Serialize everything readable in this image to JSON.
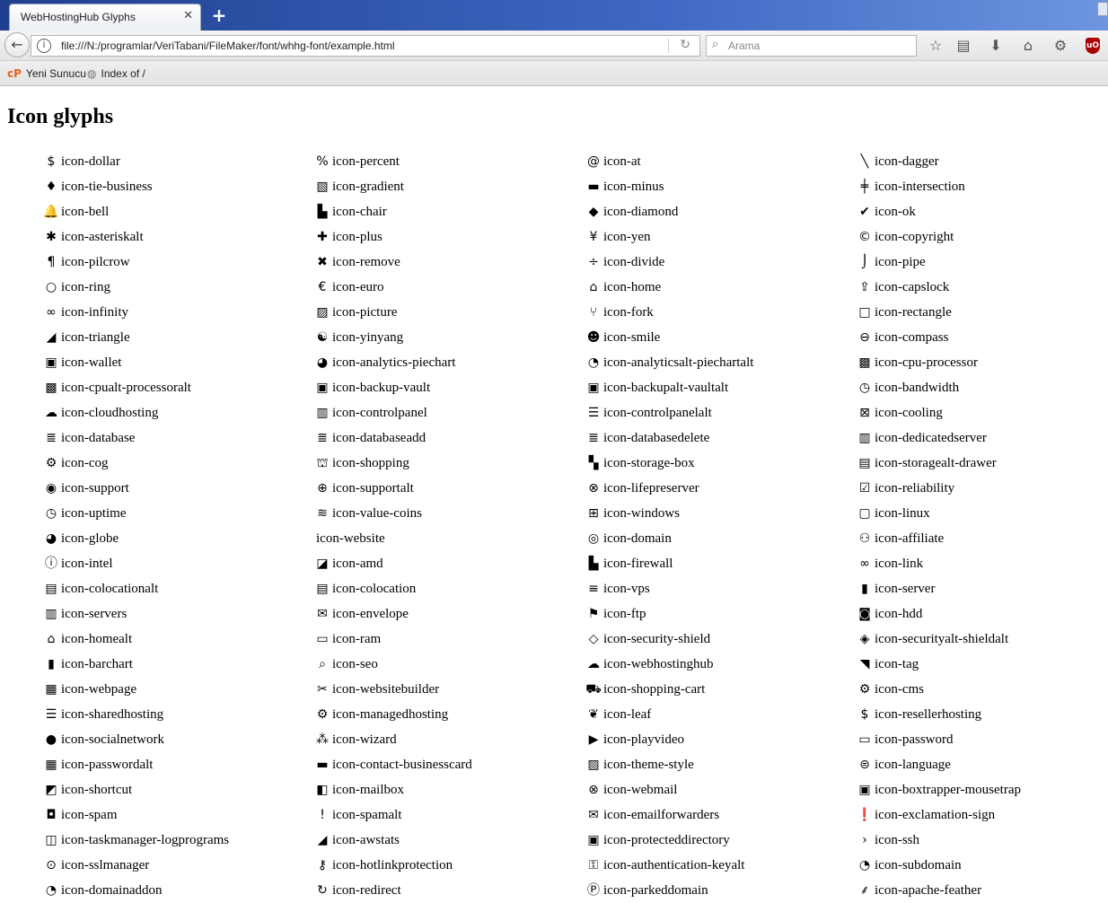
{
  "window": {
    "tab_title": "WebHostingHub Glyphs",
    "tab_close": "✕",
    "new_tab": "+"
  },
  "navbar": {
    "url": "file:///N:/programlar/VeriTabani/FileMaker/font/whhg-font/example.html",
    "search_placeholder": "Arama"
  },
  "bookmarks": [
    {
      "label": "Yeni Sunucu",
      "icon": "cpanel-icon"
    },
    {
      "label": "Index of /",
      "icon": "globe-icon"
    }
  ],
  "page": {
    "heading": "Icon glyphs"
  },
  "icon_columns": [
    [
      {
        "label": "icon-dollar",
        "glyph": "$"
      },
      {
        "label": "icon-tie-business",
        "glyph": "♦"
      },
      {
        "label": "icon-bell",
        "glyph": "🔔"
      },
      {
        "label": "icon-asteriskalt",
        "glyph": "✱"
      },
      {
        "label": "icon-pilcrow",
        "glyph": "¶"
      },
      {
        "label": "icon-ring",
        "glyph": "○"
      },
      {
        "label": "icon-infinity",
        "glyph": "∞"
      },
      {
        "label": "icon-triangle",
        "glyph": "◢"
      },
      {
        "label": "icon-wallet",
        "glyph": "▣"
      },
      {
        "label": "icon-cpualt-processoralt",
        "glyph": "▩"
      },
      {
        "label": "icon-cloudhosting",
        "glyph": "☁"
      },
      {
        "label": "icon-database",
        "glyph": "≣"
      },
      {
        "label": "icon-cog",
        "glyph": "⚙"
      },
      {
        "label": "icon-support",
        "glyph": "◉"
      },
      {
        "label": "icon-uptime",
        "glyph": "◷"
      },
      {
        "label": "icon-globe",
        "glyph": "◕"
      },
      {
        "label": "icon-intel",
        "glyph": "ⓘ"
      },
      {
        "label": "icon-colocationalt",
        "glyph": "▤"
      },
      {
        "label": "icon-servers",
        "glyph": "▥"
      },
      {
        "label": "icon-homealt",
        "glyph": "⌂"
      },
      {
        "label": "icon-barchart",
        "glyph": "▮"
      },
      {
        "label": "icon-webpage",
        "glyph": "▦"
      },
      {
        "label": "icon-sharedhosting",
        "glyph": "☰"
      },
      {
        "label": "icon-socialnetwork",
        "glyph": "●"
      },
      {
        "label": "icon-passwordalt",
        "glyph": "▦"
      },
      {
        "label": "icon-shortcut",
        "glyph": "◩"
      },
      {
        "label": "icon-spam",
        "glyph": "◘"
      },
      {
        "label": "icon-taskmanager-logprograms",
        "glyph": "◫"
      },
      {
        "label": "icon-sslmanager",
        "glyph": "⊙"
      },
      {
        "label": "icon-domainaddon",
        "glyph": "◔"
      }
    ],
    [
      {
        "label": "icon-percent",
        "glyph": "%"
      },
      {
        "label": "icon-gradient",
        "glyph": "▧"
      },
      {
        "label": "icon-chair",
        "glyph": "▙"
      },
      {
        "label": "icon-plus",
        "glyph": "✚"
      },
      {
        "label": "icon-remove",
        "glyph": "✖"
      },
      {
        "label": "icon-euro",
        "glyph": "€"
      },
      {
        "label": "icon-picture",
        "glyph": "▨"
      },
      {
        "label": "icon-yinyang",
        "glyph": "☯"
      },
      {
        "label": "icon-analytics-piechart",
        "glyph": "◕"
      },
      {
        "label": "icon-backup-vault",
        "glyph": "▣"
      },
      {
        "label": "icon-controlpanel",
        "glyph": "▥"
      },
      {
        "label": "icon-databaseadd",
        "glyph": "≣"
      },
      {
        "label": "icon-shopping",
        "glyph": "⛫"
      },
      {
        "label": "icon-supportalt",
        "glyph": "⊕"
      },
      {
        "label": "icon-value-coins",
        "glyph": "≋"
      },
      {
        "label": "icon-website",
        "glyph": ""
      },
      {
        "label": "icon-amd",
        "glyph": "◪"
      },
      {
        "label": "icon-colocation",
        "glyph": "▤"
      },
      {
        "label": "icon-envelope",
        "glyph": "✉"
      },
      {
        "label": "icon-ram",
        "glyph": "▭"
      },
      {
        "label": "icon-seo",
        "glyph": "⌕"
      },
      {
        "label": "icon-websitebuilder",
        "glyph": "✂"
      },
      {
        "label": "icon-managedhosting",
        "glyph": "⚙"
      },
      {
        "label": "icon-wizard",
        "glyph": "⁂"
      },
      {
        "label": "icon-contact-businesscard",
        "glyph": "▬"
      },
      {
        "label": "icon-mailbox",
        "glyph": "◧"
      },
      {
        "label": "icon-spamalt",
        "glyph": "!"
      },
      {
        "label": "icon-awstats",
        "glyph": "◢"
      },
      {
        "label": "icon-hotlinkprotection",
        "glyph": "⚷"
      },
      {
        "label": "icon-redirect",
        "glyph": "↻"
      }
    ],
    [
      {
        "label": "icon-at",
        "glyph": "@"
      },
      {
        "label": "icon-minus",
        "glyph": "▬"
      },
      {
        "label": "icon-diamond",
        "glyph": "◆"
      },
      {
        "label": "icon-yen",
        "glyph": "¥"
      },
      {
        "label": "icon-divide",
        "glyph": "÷"
      },
      {
        "label": "icon-home",
        "glyph": "⌂"
      },
      {
        "label": "icon-fork",
        "glyph": "⑂"
      },
      {
        "label": "icon-smile",
        "glyph": "☻"
      },
      {
        "label": "icon-analyticsalt-piechartalt",
        "glyph": "◔"
      },
      {
        "label": "icon-backupalt-vaultalt",
        "glyph": "▣"
      },
      {
        "label": "icon-controlpanelalt",
        "glyph": "☰"
      },
      {
        "label": "icon-databasedelete",
        "glyph": "≣"
      },
      {
        "label": "icon-storage-box",
        "glyph": "▚"
      },
      {
        "label": "icon-lifepreserver",
        "glyph": "⊗"
      },
      {
        "label": "icon-windows",
        "glyph": "⊞"
      },
      {
        "label": "icon-domain",
        "glyph": "◎"
      },
      {
        "label": "icon-firewall",
        "glyph": "▙"
      },
      {
        "label": "icon-vps",
        "glyph": "≡"
      },
      {
        "label": "icon-ftp",
        "glyph": "⚑"
      },
      {
        "label": "icon-security-shield",
        "glyph": "◇"
      },
      {
        "label": "icon-webhostinghub",
        "glyph": "☁"
      },
      {
        "label": "icon-shopping-cart",
        "glyph": "⛟"
      },
      {
        "label": "icon-leaf",
        "glyph": "❦"
      },
      {
        "label": "icon-playvideo",
        "glyph": "▶"
      },
      {
        "label": "icon-theme-style",
        "glyph": "▨"
      },
      {
        "label": "icon-webmail",
        "glyph": "⊗"
      },
      {
        "label": "icon-emailforwarders",
        "glyph": "✉"
      },
      {
        "label": "icon-protecteddirectory",
        "glyph": "▣"
      },
      {
        "label": "icon-authentication-keyalt",
        "glyph": "⚿"
      },
      {
        "label": "icon-parkeddomain",
        "glyph": "Ⓟ"
      }
    ],
    [
      {
        "label": "icon-dagger",
        "glyph": "╲"
      },
      {
        "label": "icon-intersection",
        "glyph": "╪"
      },
      {
        "label": "icon-ok",
        "glyph": "✔"
      },
      {
        "label": "icon-copyright",
        "glyph": "©"
      },
      {
        "label": "icon-pipe",
        "glyph": "⌡"
      },
      {
        "label": "icon-capslock",
        "glyph": "⇪"
      },
      {
        "label": "icon-rectangle",
        "glyph": "□"
      },
      {
        "label": "icon-compass",
        "glyph": "⊖"
      },
      {
        "label": "icon-cpu-processor",
        "glyph": "▩"
      },
      {
        "label": "icon-bandwidth",
        "glyph": "◷"
      },
      {
        "label": "icon-cooling",
        "glyph": "⊠"
      },
      {
        "label": "icon-dedicatedserver",
        "glyph": "▥"
      },
      {
        "label": "icon-storagealt-drawer",
        "glyph": "▤"
      },
      {
        "label": "icon-reliability",
        "glyph": "☑"
      },
      {
        "label": "icon-linux",
        "glyph": "▢"
      },
      {
        "label": "icon-affiliate",
        "glyph": "⚇"
      },
      {
        "label": "icon-link",
        "glyph": "∞"
      },
      {
        "label": "icon-server",
        "glyph": "▮"
      },
      {
        "label": "icon-hdd",
        "glyph": "◙"
      },
      {
        "label": "icon-securityalt-shieldalt",
        "glyph": "◈"
      },
      {
        "label": "icon-tag",
        "glyph": "◥"
      },
      {
        "label": "icon-cms",
        "glyph": "⚙"
      },
      {
        "label": "icon-resellerhosting",
        "glyph": "$"
      },
      {
        "label": "icon-password",
        "glyph": "▭"
      },
      {
        "label": "icon-language",
        "glyph": "⊜"
      },
      {
        "label": "icon-boxtrapper-mousetrap",
        "glyph": "▣"
      },
      {
        "label": "icon-exclamation-sign",
        "glyph": "❗"
      },
      {
        "label": "icon-ssh",
        "glyph": "›"
      },
      {
        "label": "icon-subdomain",
        "glyph": "◔"
      },
      {
        "label": "icon-apache-feather",
        "glyph": "⸙"
      }
    ]
  ]
}
